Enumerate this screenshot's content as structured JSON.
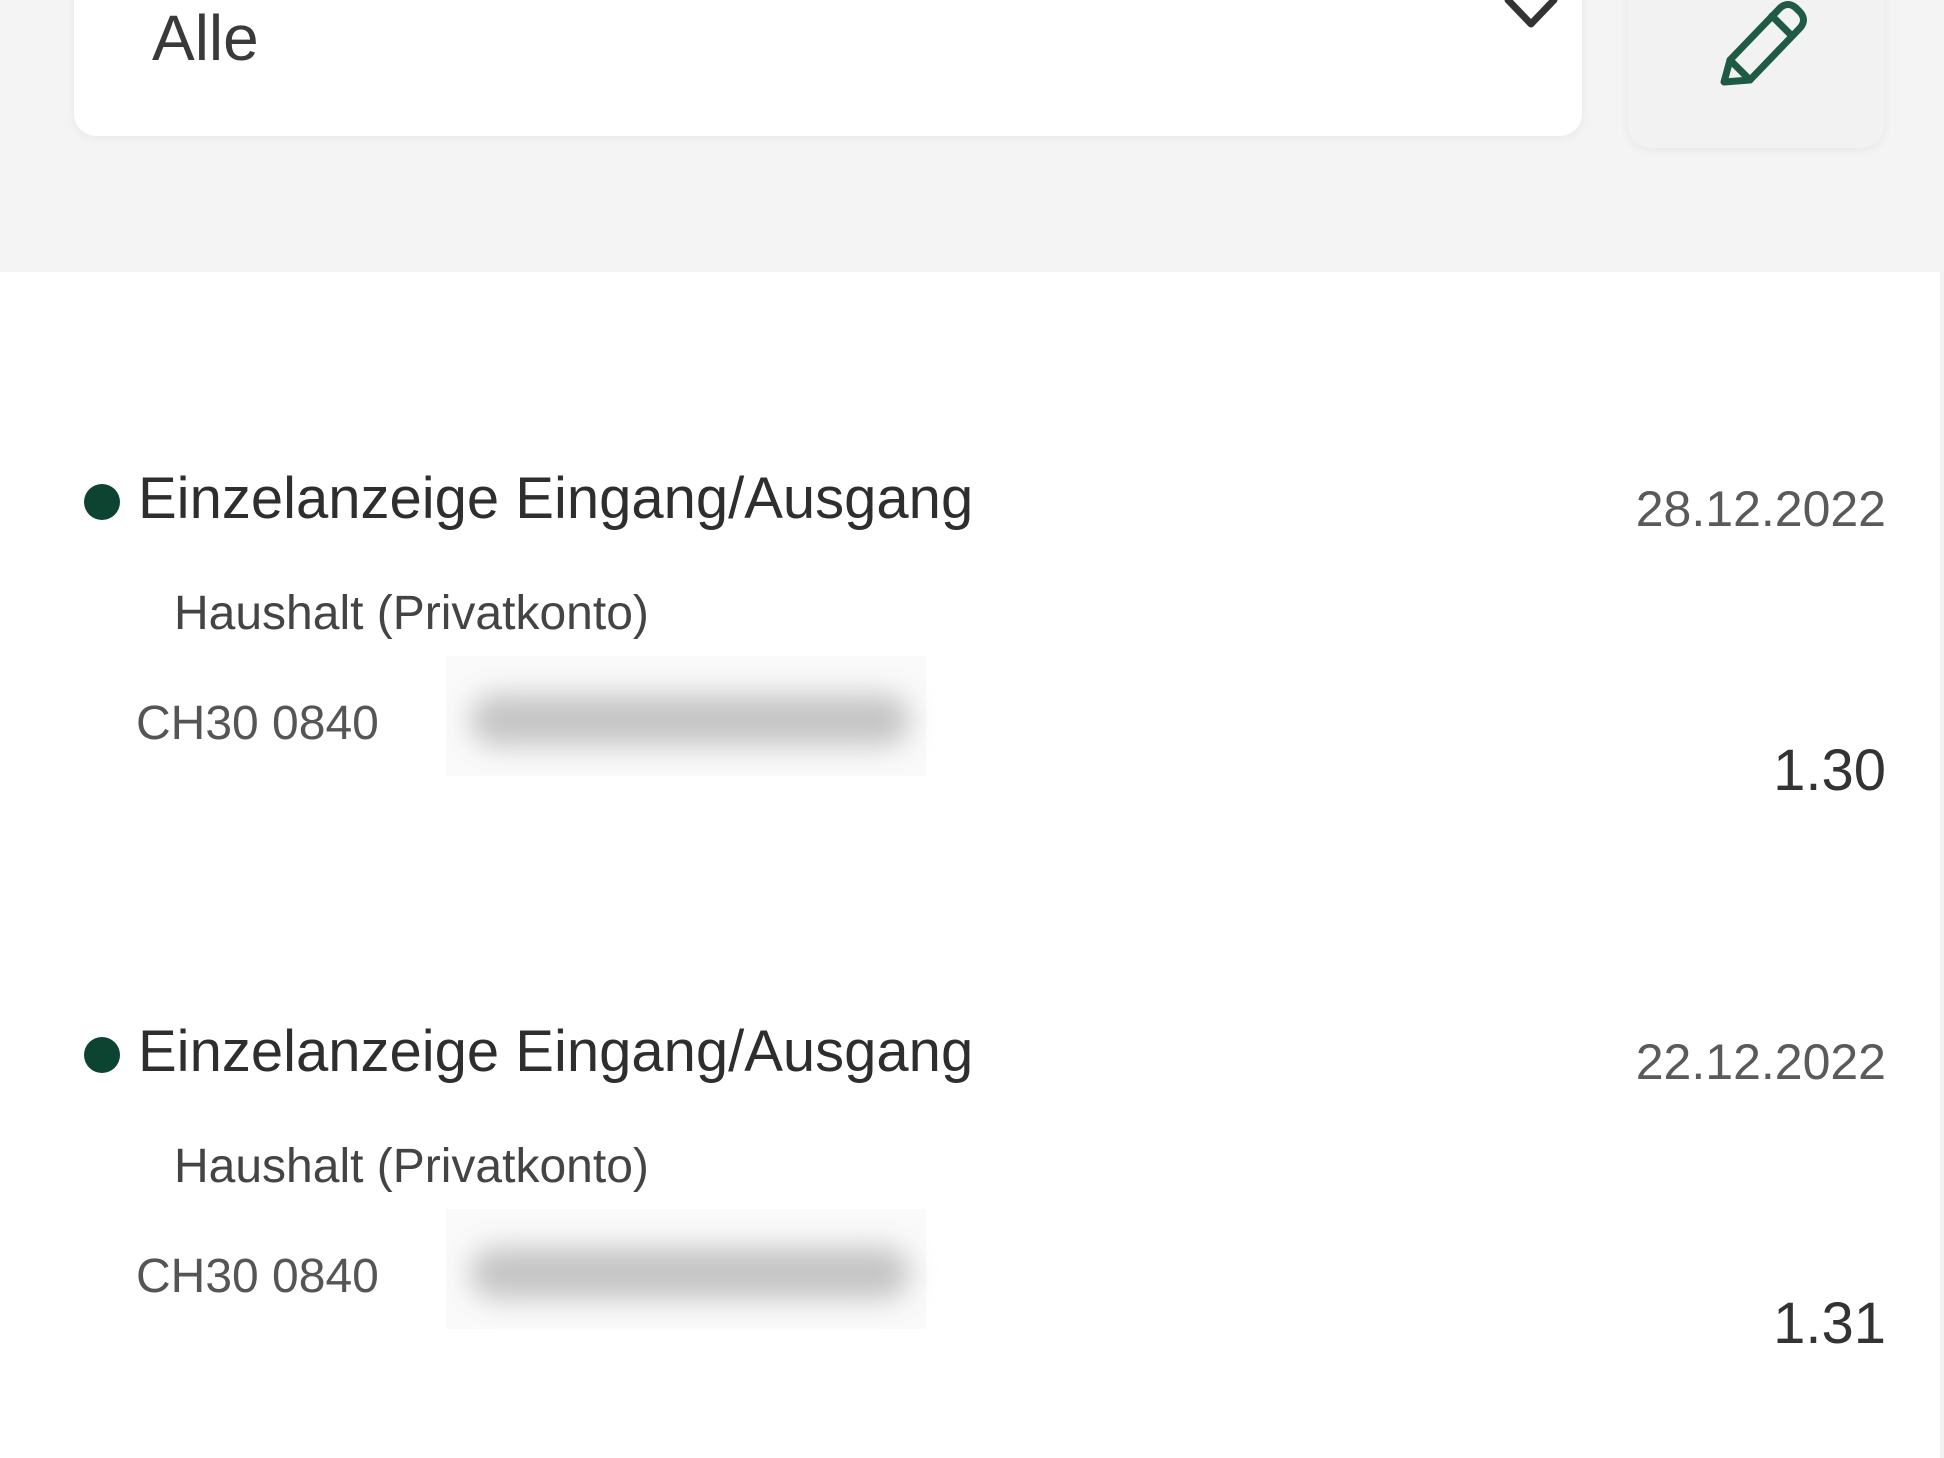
{
  "filter": {
    "selected": "Alle",
    "chevron_icon": "chevron-down-icon",
    "edit_icon": "pencil-icon"
  },
  "colors": {
    "accent": "#0c4431",
    "panel_bg": "#f4f4f4"
  },
  "transactions": [
    {
      "title": "Einzelanzeige Eingang/Ausgang",
      "subtitle": "Haushalt (Privatkonto)",
      "iban": "CH30 0840",
      "date": "28.12.2022",
      "amount": "1.30"
    },
    {
      "title": "Einzelanzeige Eingang/Ausgang",
      "subtitle": "Haushalt (Privatkonto)",
      "iban": "CH30 0840",
      "date": "22.12.2022",
      "amount": "1.31"
    }
  ]
}
